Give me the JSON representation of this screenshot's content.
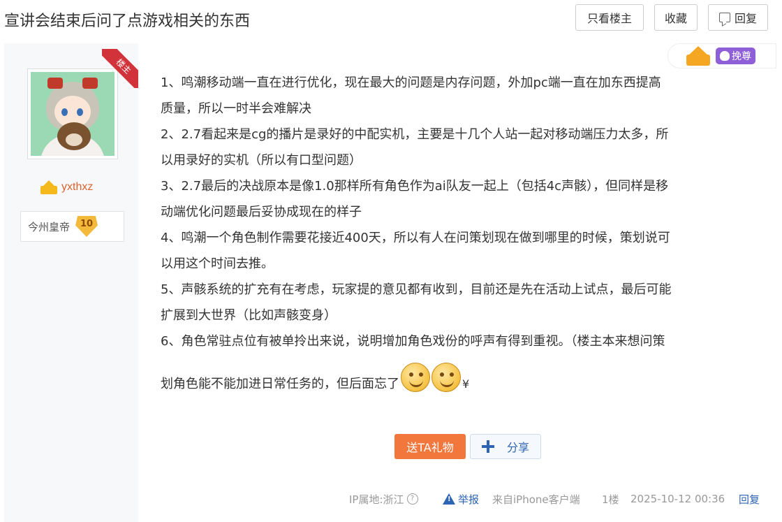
{
  "header": {
    "title": "宣讲会结束后问了点游戏相关的东西",
    "only_author_label": "只看楼主",
    "favorite_label": "收藏",
    "reply_label": "回复"
  },
  "user": {
    "name": "yxthxz",
    "level_name": "今州皇帝",
    "level_number": "10",
    "role_ribbon": "楼主"
  },
  "cheer": {
    "label": "挽尊"
  },
  "post": {
    "lines": [
      "1、鸣潮移动端一直在进行优化，现在最大的问题是内存问题，外加pc端一直在加东西提高",
      "质量，所以一时半会难解决",
      "2、2.7看起来是cg的播片是录好的中配实机，主要是十几个人站一起对移动端压力太多，所",
      "以用录好的实机（所以有口型问题）",
      "3、2.7最后的决战原本是像1.0那样所有角色作为ai队友一起上（包括4c声骸），但同样是移",
      "动端优化问题最后妥协成现在的样子",
      "4、鸣潮一个角色制作需要花接近400天，所以有人在问策划现在做到哪里的时候，策划说可",
      "以用这个时间去推。",
      "5、声骸系统的扩充有在考虑，玩家提的意见都有收到，目前还是先在活动上试点，最后可能",
      "扩展到大世界（比如声骸变身）",
      "6、角色常驻点位有被单拎出来说，说明增加角色戏份的呼声有得到重视。（楼主本来想问策"
    ],
    "last_line": "划角色能不能加进日常任务的，但后面忘了",
    "last_line_suffix": "¥"
  },
  "actions": {
    "gift_label": "送TA礼物",
    "share_label": "分享"
  },
  "footer": {
    "ip_label": "IP属地:浙江",
    "report_label": "举报",
    "source_label": "来自iPhone客户端",
    "floor_label": "1楼",
    "time_label": "2025-10-12 00:36",
    "reply_label": "回复"
  },
  "colors": {
    "accent_orange": "#f2773d",
    "link_blue": "#2d64b3",
    "username_orange": "#e0632b",
    "ribbon_red": "#d2333a",
    "cheer_purple": "#8e5fd6"
  }
}
